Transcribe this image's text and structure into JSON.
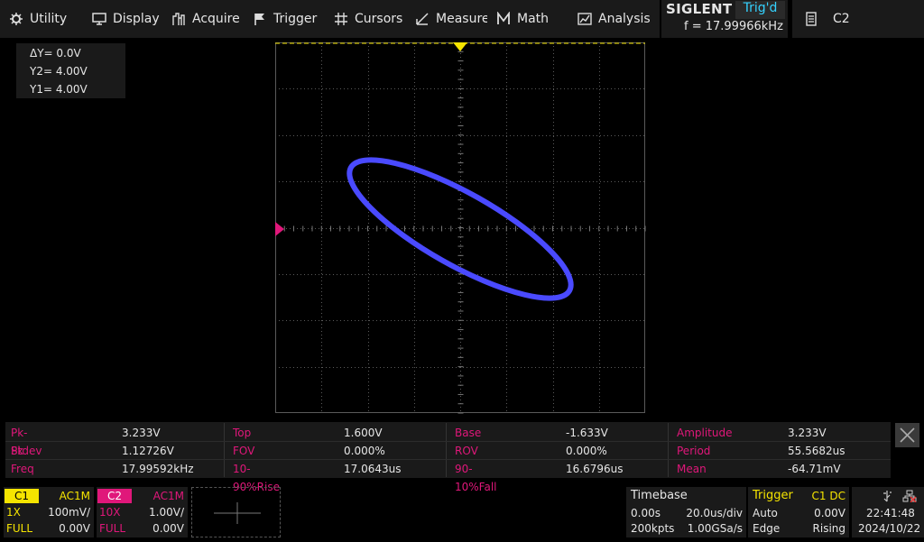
{
  "menu": {
    "items": [
      {
        "label": "Utility",
        "icon": "utility-icon"
      },
      {
        "label": "Display",
        "icon": "display-icon"
      },
      {
        "label": "Acquire",
        "icon": "acquire-icon"
      },
      {
        "label": "Trigger",
        "icon": "trigger-flag-icon"
      },
      {
        "label": "Cursors",
        "icon": "cursors-icon"
      },
      {
        "label": "Measure",
        "icon": "measure-icon"
      },
      {
        "label": "Math",
        "icon": "math-icon"
      },
      {
        "label": "Analysis",
        "icon": "analysis-icon"
      }
    ]
  },
  "brand": {
    "logo": "SIGLENT",
    "trig_state": "Trig'd",
    "frequency": "f = 17.99966kHz"
  },
  "channel_tab": {
    "label": "C2"
  },
  "cursor_info": {
    "delta_y": "ΔY= 0.0V",
    "y2": "Y2= 4.00V",
    "y1": "Y1= 4.00V"
  },
  "measurements": [
    {
      "label": "Pk-Pk",
      "value": "3.233V"
    },
    {
      "label": "Top",
      "value": "1.600V"
    },
    {
      "label": "Base",
      "value": "-1.633V"
    },
    {
      "label": "Amplitude",
      "value": "3.233V"
    },
    {
      "label": "Stdev",
      "value": "1.12726V"
    },
    {
      "label": "FOV",
      "value": "0.000%"
    },
    {
      "label": "ROV",
      "value": "0.000%"
    },
    {
      "label": "Period",
      "value": "55.5682us"
    },
    {
      "label": "Freq",
      "value": "17.99592kHz"
    },
    {
      "label": "10-90%Rise",
      "value": "17.0643us"
    },
    {
      "label": "90-10%Fall",
      "value": "16.6796us"
    },
    {
      "label": "Mean",
      "value": "-64.71mV"
    }
  ],
  "channels": [
    {
      "tag": "C1",
      "coupling": "AC1M",
      "probe": "1X",
      "scale": "100mV/",
      "bw": "FULL",
      "offset": "0.00V",
      "color": "#f5e400"
    },
    {
      "tag": "C2",
      "coupling": "AC1M",
      "probe": "10X",
      "scale": "1.00V/",
      "bw": "FULL",
      "offset": "0.00V",
      "color": "#e0177a"
    }
  ],
  "timebase": {
    "title": "Timebase",
    "delay": "0.00s",
    "scale": "20.0us/div",
    "memory": "200kpts",
    "sample_rate": "1.00GSa/s"
  },
  "trigger": {
    "title": "Trigger",
    "source": "C1 DC",
    "mode": "Auto",
    "level": "0.00V",
    "type": "Edge",
    "slope": "Rising"
  },
  "clock": {
    "time": "22:41:48",
    "date": "2024/10/22"
  },
  "colors": {
    "trace": "#4a4aff",
    "accent_yellow": "#f5e400",
    "accent_magenta": "#e0177a",
    "trig_cyan": "#34d2ff"
  }
}
